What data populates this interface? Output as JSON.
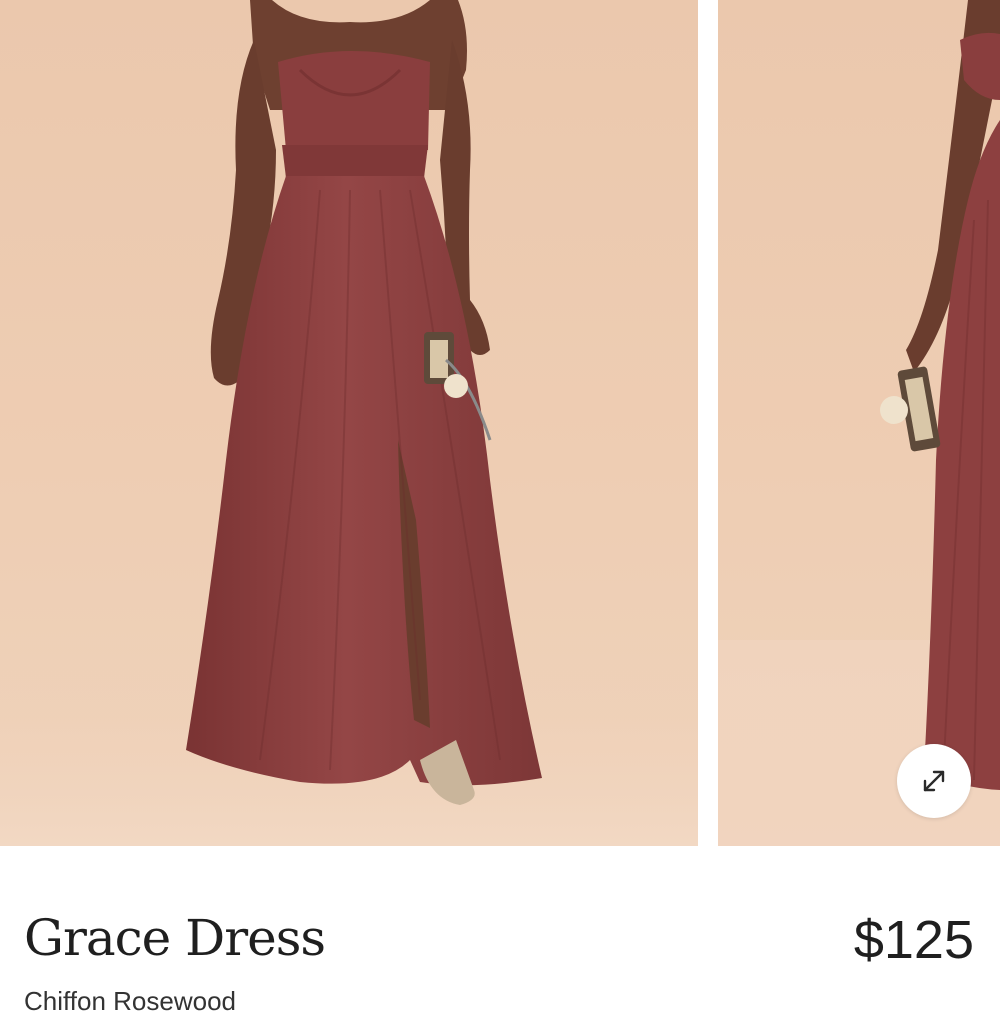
{
  "gallery": {
    "images": [
      {
        "alt": "Model wearing strapless Grace Dress in rose red chiffon"
      },
      {
        "alt": "Model wearing off-shoulder Grace Dress, side view"
      }
    ],
    "expand_icon": "expand-arrows-icon"
  },
  "product": {
    "title": "Grace Dress",
    "price": "$125",
    "subtitle": "Chiffon Rosewood"
  },
  "colors": {
    "backdrop": "#ebc8ad",
    "dress": "#8c3f3f",
    "skin": "#6e4030",
    "text": "#1f1f1f"
  }
}
